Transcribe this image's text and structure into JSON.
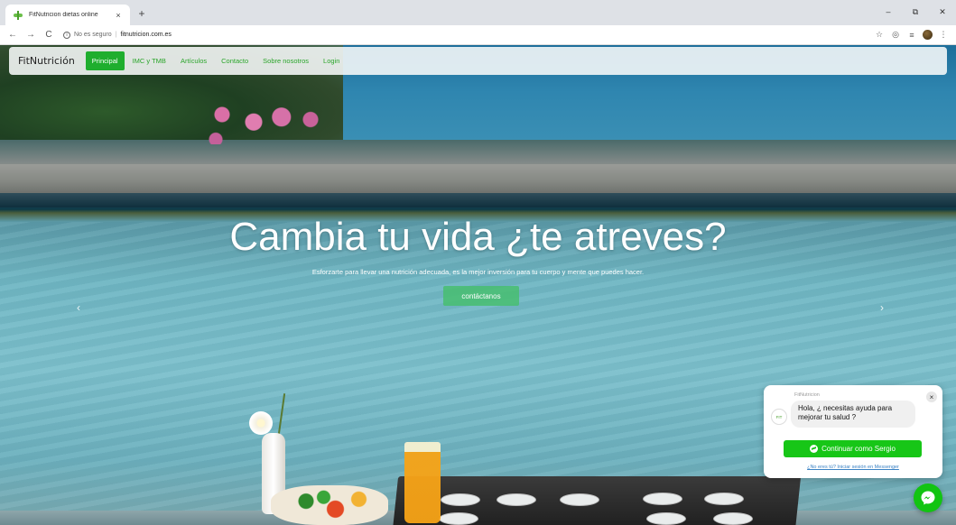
{
  "browser": {
    "tab_title": "FitNutricion dietas online",
    "tab_close": "×",
    "new_tab": "+",
    "window_minimize": "–",
    "window_restore": "⧉",
    "window_close": "✕",
    "back": "←",
    "forward": "→",
    "reload": "C",
    "security_text": "No es seguro",
    "url": "fitnutricion.com.es"
  },
  "navbar": {
    "brand": "FitNutrición",
    "links": [
      {
        "label": "Principal",
        "active": true
      },
      {
        "label": "IMC y TMB"
      },
      {
        "label": "Artículos"
      },
      {
        "label": "Contacto"
      },
      {
        "label": "Sobre nosotros"
      },
      {
        "label": "Login"
      }
    ]
  },
  "hero": {
    "title": "Cambia tu vida ¿te atreves?",
    "subtitle": "Esforzarte para llevar una nutrición adecuada, es la mejor inversión para tu cuerpo y mente que puedes hacer.",
    "button_label": "contáctanos",
    "prev_arrow": "‹",
    "next_arrow": "›"
  },
  "chat": {
    "page_name": "FitNutricion",
    "avatar_text": "FIT",
    "close": "×",
    "message": "Hola, ¿ necesitas ayuda para mejorar tu salud ?",
    "continue_button": "Continuar como Sergio",
    "not_you_link": "¿No eres tú? Iniciar sesión en Messenger"
  },
  "colors": {
    "accent_green": "#1fae2e",
    "messenger_green": "#12c412"
  }
}
